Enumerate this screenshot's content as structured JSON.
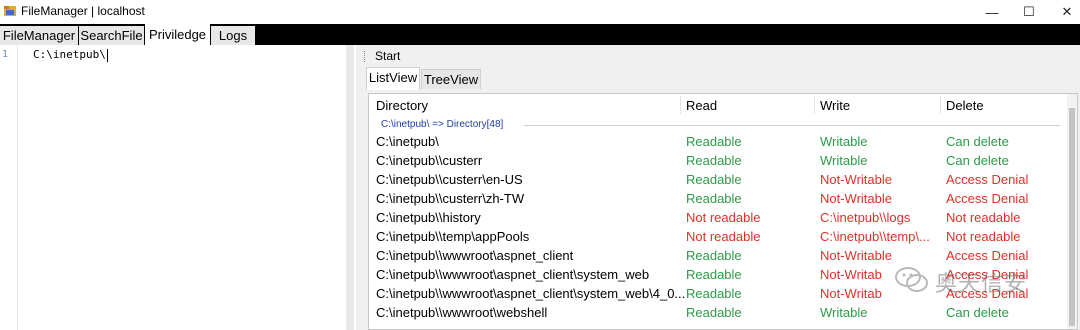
{
  "window": {
    "title": "FileManager | localhost",
    "minimize_glyph": "—",
    "maximize_glyph": "☐",
    "close_glyph": "✕"
  },
  "tabs": [
    {
      "label": "FileManager"
    },
    {
      "label": "SearchFile"
    },
    {
      "label": "Priviledge"
    },
    {
      "label": "Logs"
    }
  ],
  "editor": {
    "line_number": "1",
    "text": "C:\\inetpub\\"
  },
  "toolbar": {
    "start_label": "Start"
  },
  "subtabs": [
    {
      "label": "ListView"
    },
    {
      "label": "TreeView"
    }
  ],
  "listview": {
    "columns": [
      "Directory",
      "Read",
      "Write",
      "Delete"
    ],
    "group": "C:\\inetpub\\ => Directory[48]",
    "rows": [
      {
        "dir": "C:\\inetpub\\",
        "read": "Readable",
        "write": "Writable",
        "delete": "Can delete"
      },
      {
        "dir": "C:\\inetpub\\\\custerr",
        "read": "Readable",
        "write": "Writable",
        "delete": "Can delete"
      },
      {
        "dir": "C:\\inetpub\\\\custerr\\en-US",
        "read": "Readable",
        "write": "Not-Writable",
        "delete": "Access Denial"
      },
      {
        "dir": "C:\\inetpub\\\\custerr\\zh-TW",
        "read": "Readable",
        "write": "Not-Writable",
        "delete": "Access Denial"
      },
      {
        "dir": "C:\\inetpub\\\\history",
        "read": "Not readable",
        "write": "C:\\inetpub\\\\logs",
        "delete": "Not readable"
      },
      {
        "dir": "C:\\inetpub\\\\temp\\appPools",
        "read": "Not readable",
        "write": "C:\\inetpub\\\\temp\\...",
        "delete": "Not readable"
      },
      {
        "dir": "C:\\inetpub\\\\wwwroot\\aspnet_client",
        "read": "Readable",
        "write": "Not-Writable",
        "delete": "Access Denial"
      },
      {
        "dir": "C:\\inetpub\\\\wwwroot\\aspnet_client\\system_web",
        "read": "Readable",
        "write": "Not-Writab",
        "delete": "Access Denial"
      },
      {
        "dir": "C:\\inetpub\\\\wwwroot\\aspnet_client\\system_web\\4_0...",
        "read": "Readable",
        "write": "Not-Writab",
        "delete": "Access Denial"
      },
      {
        "dir": "C:\\inetpub\\\\wwwroot\\webshell",
        "read": "Readable",
        "write": "Writable",
        "delete": "Can delete"
      }
    ]
  },
  "watermark": {
    "text": "奥天信安",
    "icon": "wechat-icon"
  },
  "colors": {
    "positive": "#2e9a4a",
    "negative": "#e0302a",
    "group": "#1f3fa8"
  }
}
